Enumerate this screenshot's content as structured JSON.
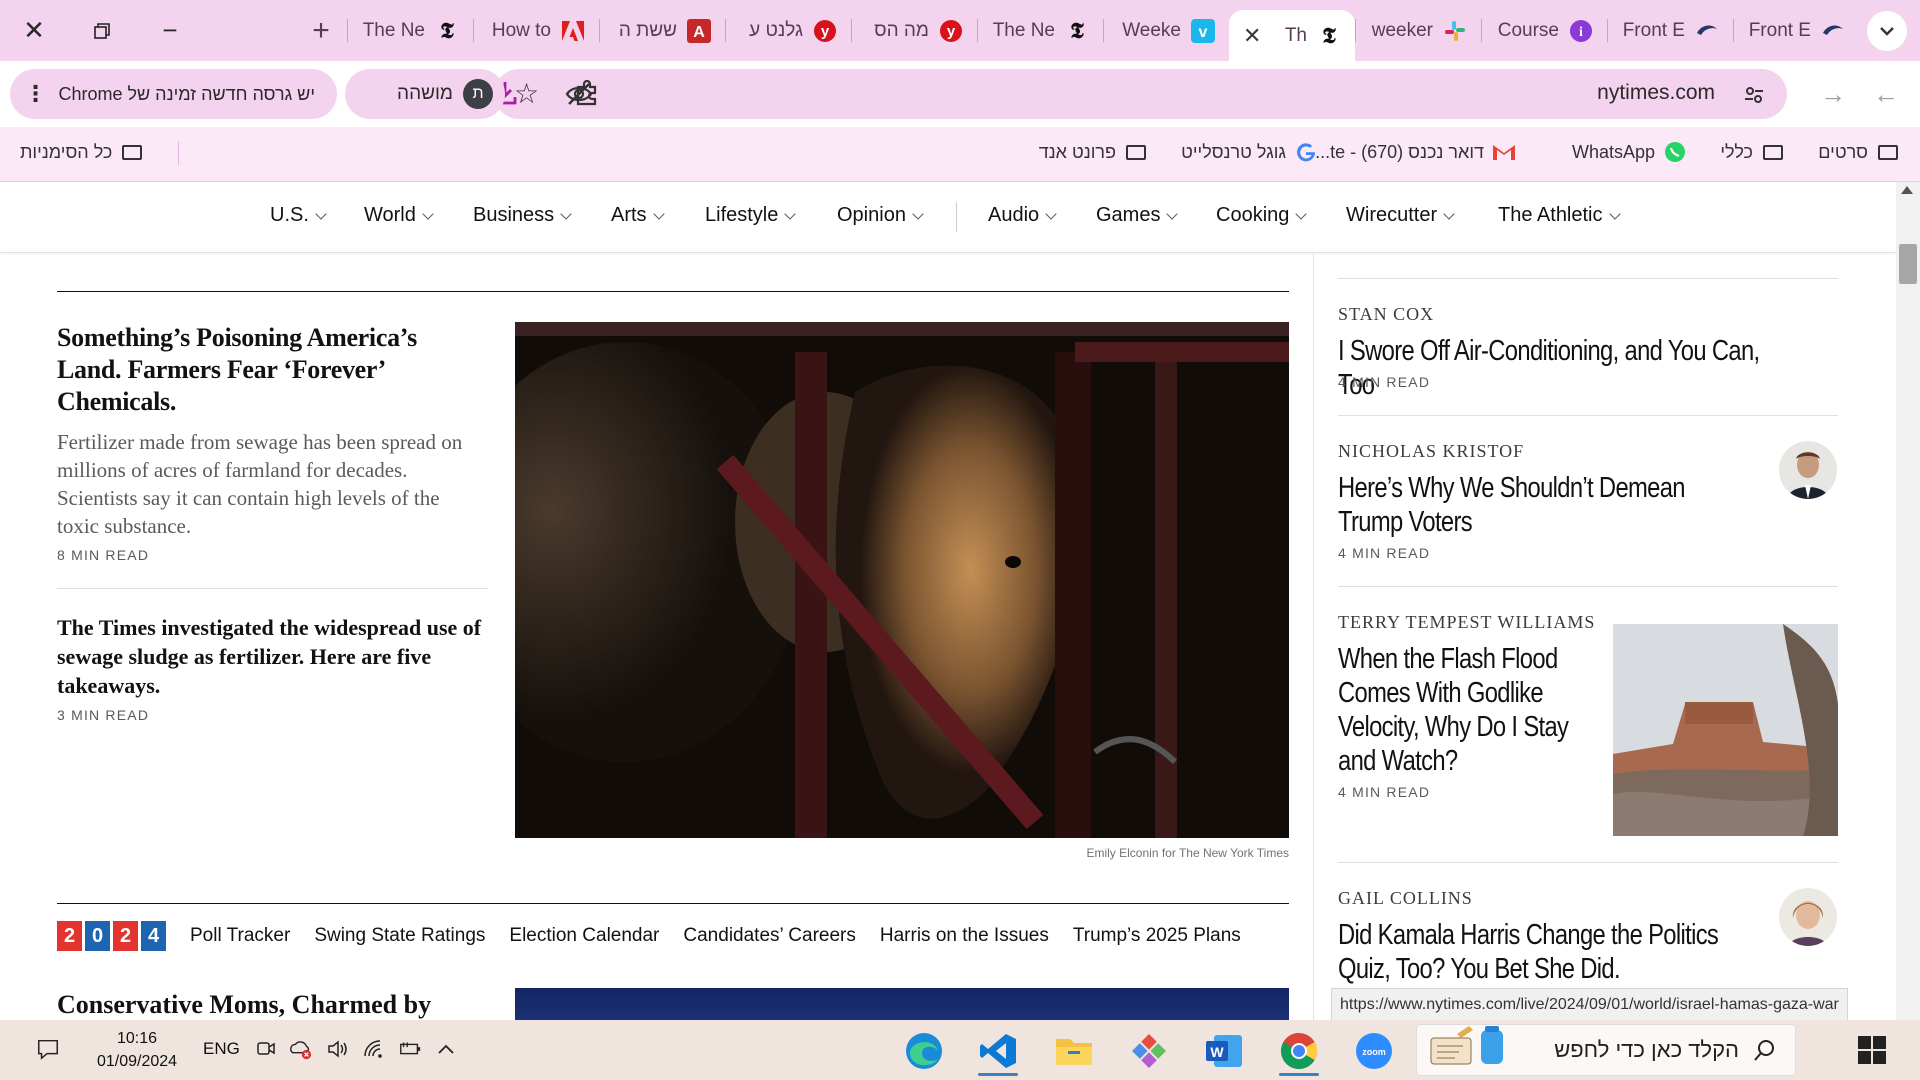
{
  "browser": {
    "tabs": [
      {
        "title": "The Ne",
        "favicon": "nyt-icon"
      },
      {
        "title": "How to",
        "favicon": "adobe-icon"
      },
      {
        "title": "ששת ה",
        "favicon": "letter-a-icon"
      },
      {
        "title": "גלנט ע",
        "favicon": "ynet-icon"
      },
      {
        "title": "מה הס",
        "favicon": "ynet-icon"
      },
      {
        "title": "The Ne",
        "favicon": "nyt-icon"
      },
      {
        "title": "Weeke",
        "favicon": "vimeo-icon"
      },
      {
        "title": "Th",
        "favicon": "nyt-icon",
        "active": true
      },
      {
        "title": "weeker",
        "favicon": "slack-icon"
      },
      {
        "title": "Course",
        "favicon": "info-icon"
      },
      {
        "title": "Front E",
        "favicon": "bird-icon"
      },
      {
        "title": "Front E",
        "favicon": "bird-icon"
      }
    ],
    "address": "nytimes.com",
    "profile_initial": "ת",
    "profile_name": "מושהה",
    "update_notice": "יש גרסה חדשה זמינה של Chrome",
    "bookmarks": [
      {
        "label": "סרטים",
        "icon": "folder-icon"
      },
      {
        "label": "כללי",
        "icon": "folder-icon"
      },
      {
        "label": "WhatsApp",
        "icon": "whatsapp-icon"
      },
      {
        "label": "דואר נכנס (670) - te...",
        "icon": "gmail-icon"
      },
      {
        "label": "גוגל טרנסלייט",
        "icon": "google-icon"
      },
      {
        "label": "פרונט אנד",
        "icon": "folder-icon"
      }
    ],
    "all_bookmarks": "כל הסימניות",
    "status_url": "https://www.nytimes.com/live/2024/09/01/world/israel-hamas-gaza-war"
  },
  "nyt": {
    "nav": [
      "U.S.",
      "World",
      "Business",
      "Arts",
      "Lifestyle",
      "Opinion",
      "Audio",
      "Games",
      "Cooking",
      "Wirecutter",
      "The Athletic"
    ],
    "lead": {
      "headline": "Something’s Poisoning America’s Land. Farmers Fear ‘Forever’ Chemicals.",
      "summary": "Fertilizer made from sewage has been spread on millions of acres of farmland for decades. Scientists say it can contain high levels of the toxic substance.",
      "read": "8 MIN READ",
      "caption": "Emily Elconin for The New York Times"
    },
    "second": {
      "headline": "The Times investigated the widespread use of sewage sludge as fertilizer. Here are five takeaways.",
      "read": "3 MIN READ"
    },
    "election": {
      "year": [
        "2",
        "0",
        "2",
        "4"
      ],
      "links": [
        "Poll Tracker",
        "Swing State Ratings",
        "Election Calendar",
        "Candidates’ Careers",
        "Harris on the Issues",
        "Trump’s 2025 Plans"
      ]
    },
    "third_headline": "Conservative Moms, Charmed by",
    "opinion": [
      {
        "author": "STAN COX",
        "headline": "I Swore Off Air-Conditioning, and You Can, Too",
        "read": "4 MIN READ"
      },
      {
        "author": "NICHOLAS KRISTOF",
        "headline": "Here’s Why We Shouldn’t Demean Trump Voters",
        "read": "4 MIN READ"
      },
      {
        "author": "TERRY TEMPEST WILLIAMS",
        "headline": "When the Flash Flood Comes With Godlike Velocity, Why Do I Stay and Watch?",
        "read": "4 MIN READ"
      },
      {
        "author": "GAIL COLLINS",
        "headline": "Did Kamala Harris Change the Politics Quiz, Too? You Bet She Did."
      }
    ]
  },
  "taskbar": {
    "time": "10:16",
    "date": "01/09/2024",
    "lang": "ENG",
    "search_placeholder": "הקלד כאן כדי לחפש",
    "apps": [
      "edge-icon",
      "vscode-icon",
      "file-explorer-icon",
      "git-icon",
      "word-icon",
      "chrome-icon",
      "zoom-icon"
    ]
  }
}
